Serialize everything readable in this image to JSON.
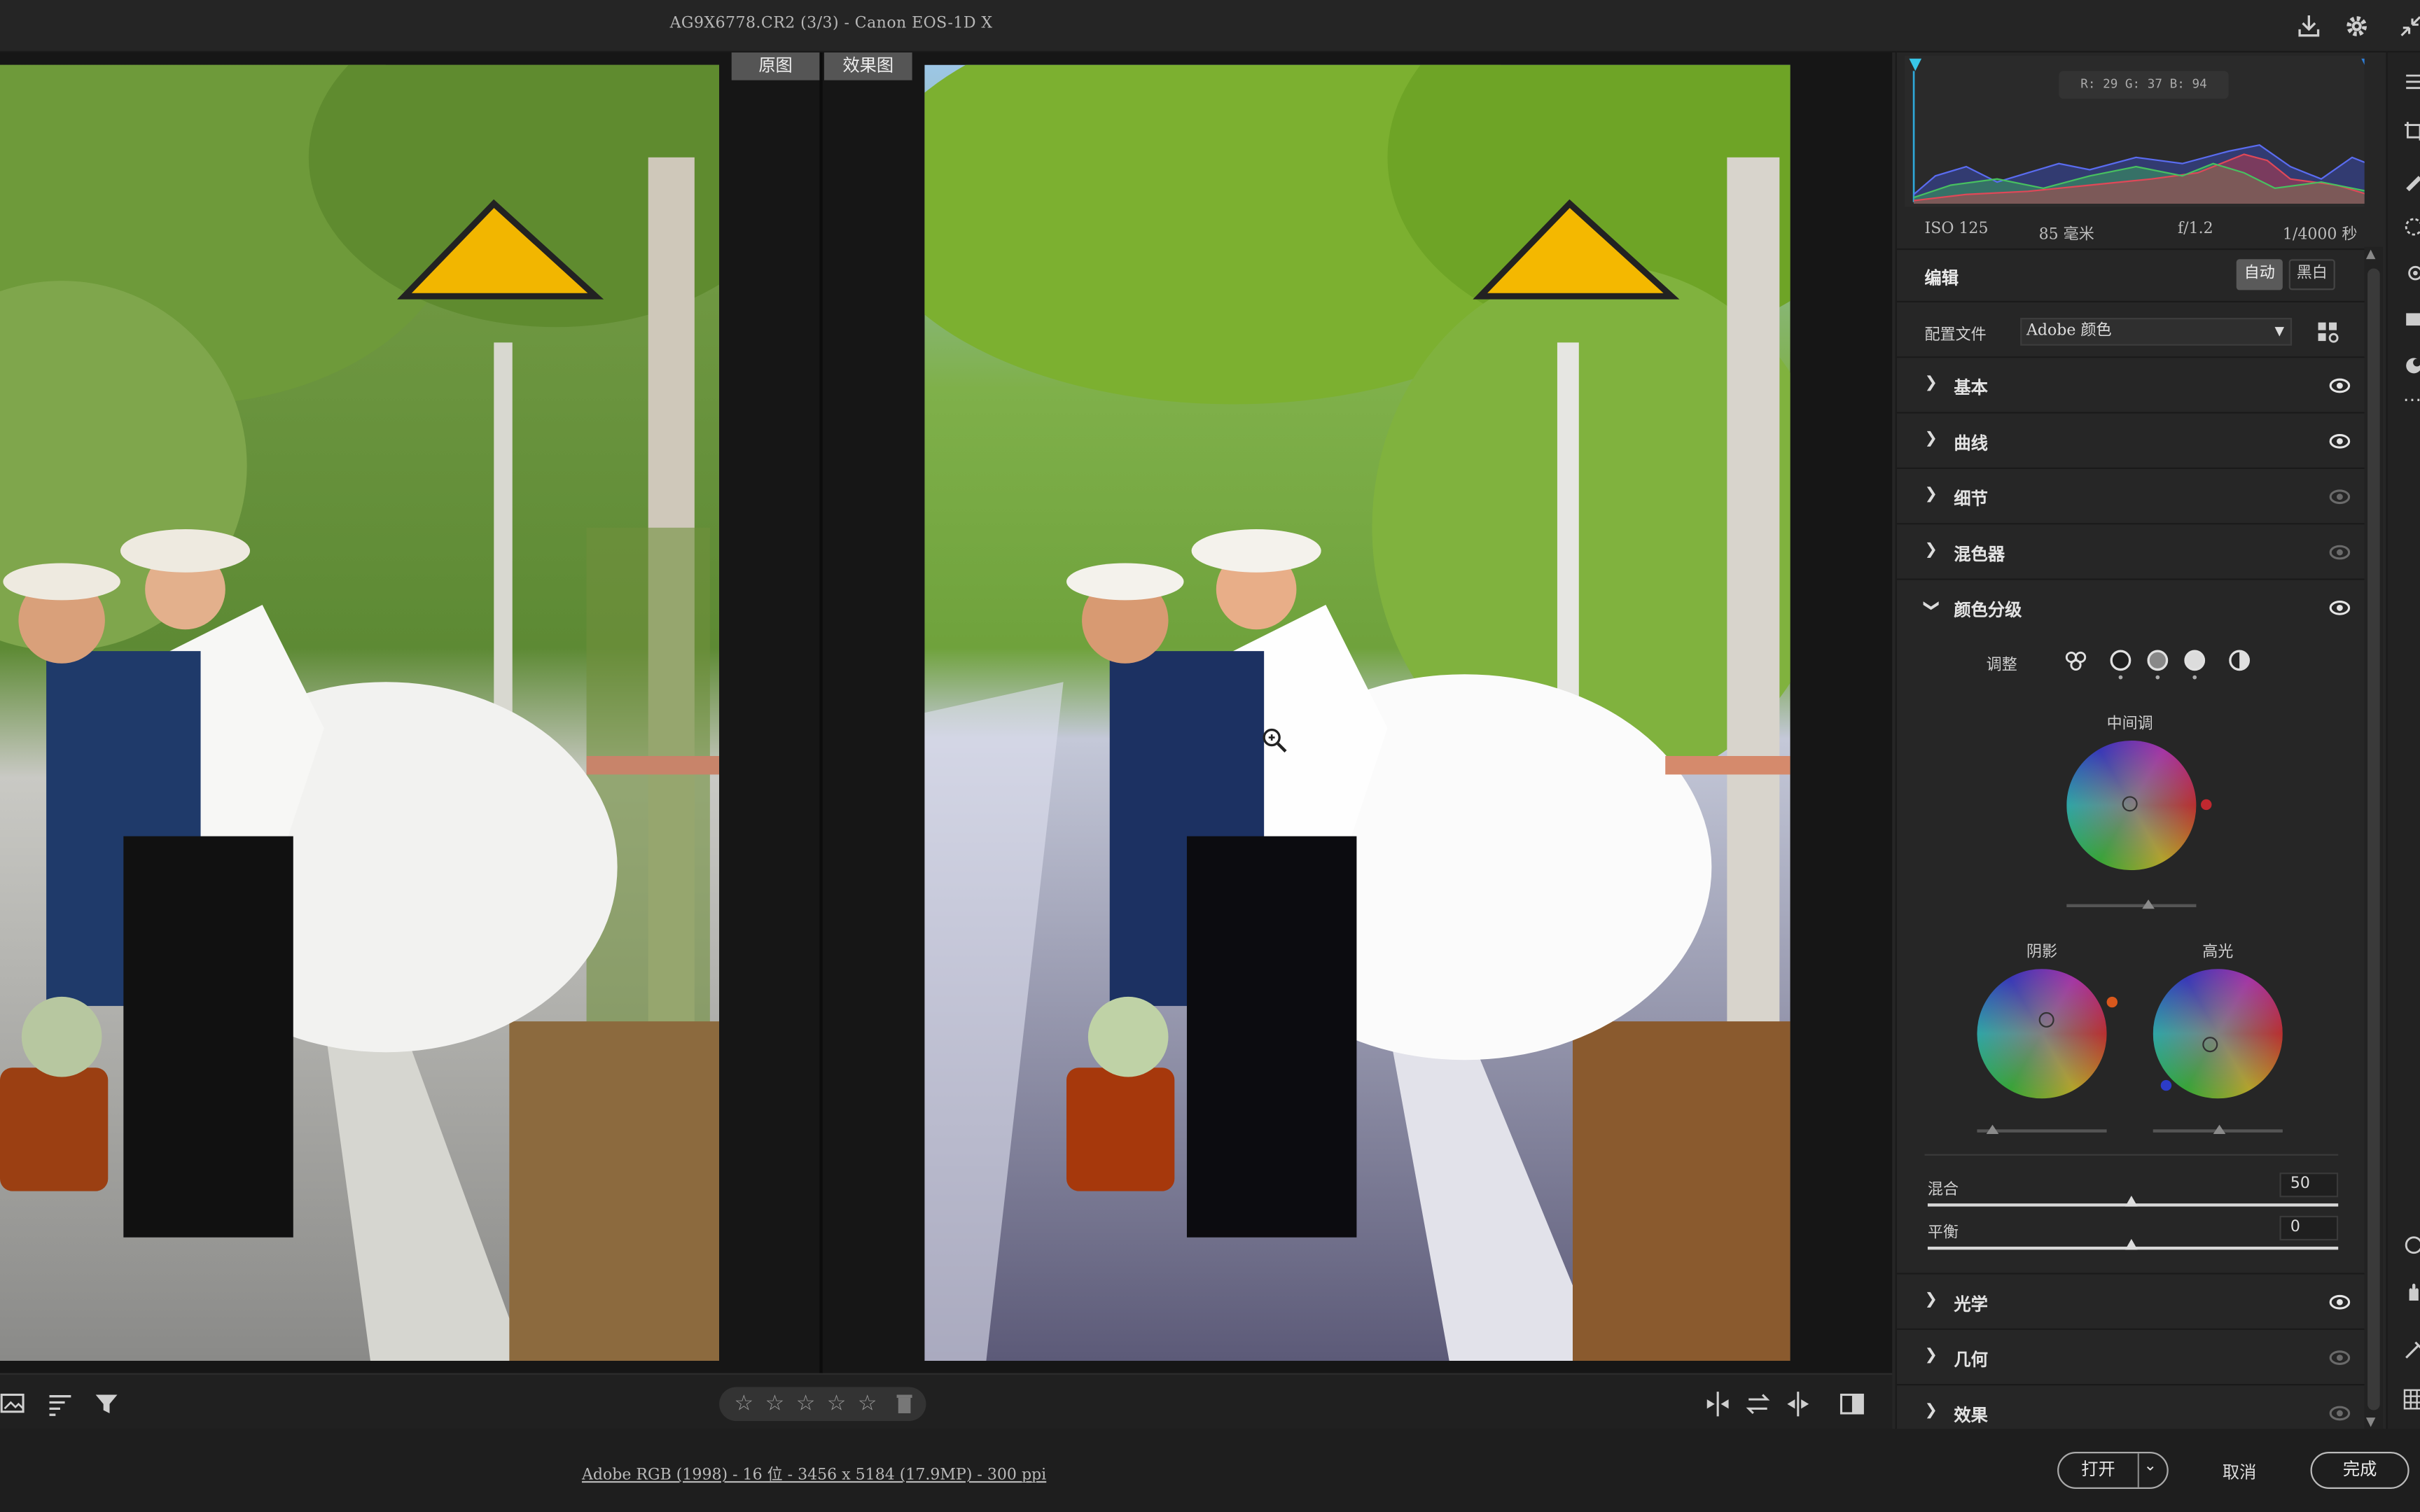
{
  "window": {
    "title": "AG9X6778.CR2 (3/3) -  Canon EOS-1D X"
  },
  "view": {
    "tab_before": "原图",
    "tab_after": "效果图"
  },
  "histogram": {
    "readout": "R: 29   G: 37   B: 94",
    "exif": {
      "iso": "ISO 125",
      "focal": "85 毫米",
      "aperture": "f/1.2",
      "shutter": "1/4000 秒"
    }
  },
  "edit": {
    "title": "编辑",
    "auto": "自动",
    "bw": "黑白",
    "profile_label": "配置文件",
    "profile_value": "Adobe 颜色"
  },
  "sections": {
    "basic": "基本",
    "curve": "曲线",
    "detail": "细节",
    "mixer": "混色器",
    "color_grading": "颜色分级",
    "optics": "光学",
    "geometry": "几何",
    "effects": "效果"
  },
  "color_grading": {
    "adjust_label": "调整",
    "midtones": "中间调",
    "shadows": "阴影",
    "highlights": "高光",
    "blending_label": "混合",
    "blending_value": "50",
    "balance_label": "平衡",
    "balance_value": "0",
    "colors": {
      "midtone_dot": "#c0282f",
      "shadow_dot": "#d8581c",
      "highlight_dot": "#2c3cc8"
    }
  },
  "toolbar": {
    "rating_stars": [
      "☆",
      "☆",
      "☆",
      "☆",
      "☆"
    ]
  },
  "status": {
    "file_info": "Adobe RGB (1998) - 16 位 - 3456 x 5184 (17.9MP) - 300 ppi",
    "open": "打开",
    "cancel": "取消",
    "done": "完成"
  },
  "icons": {
    "save": "download-icon",
    "settings": "gear-icon",
    "collapse": "collapse-icon"
  },
  "accent": "#2fa8d8"
}
